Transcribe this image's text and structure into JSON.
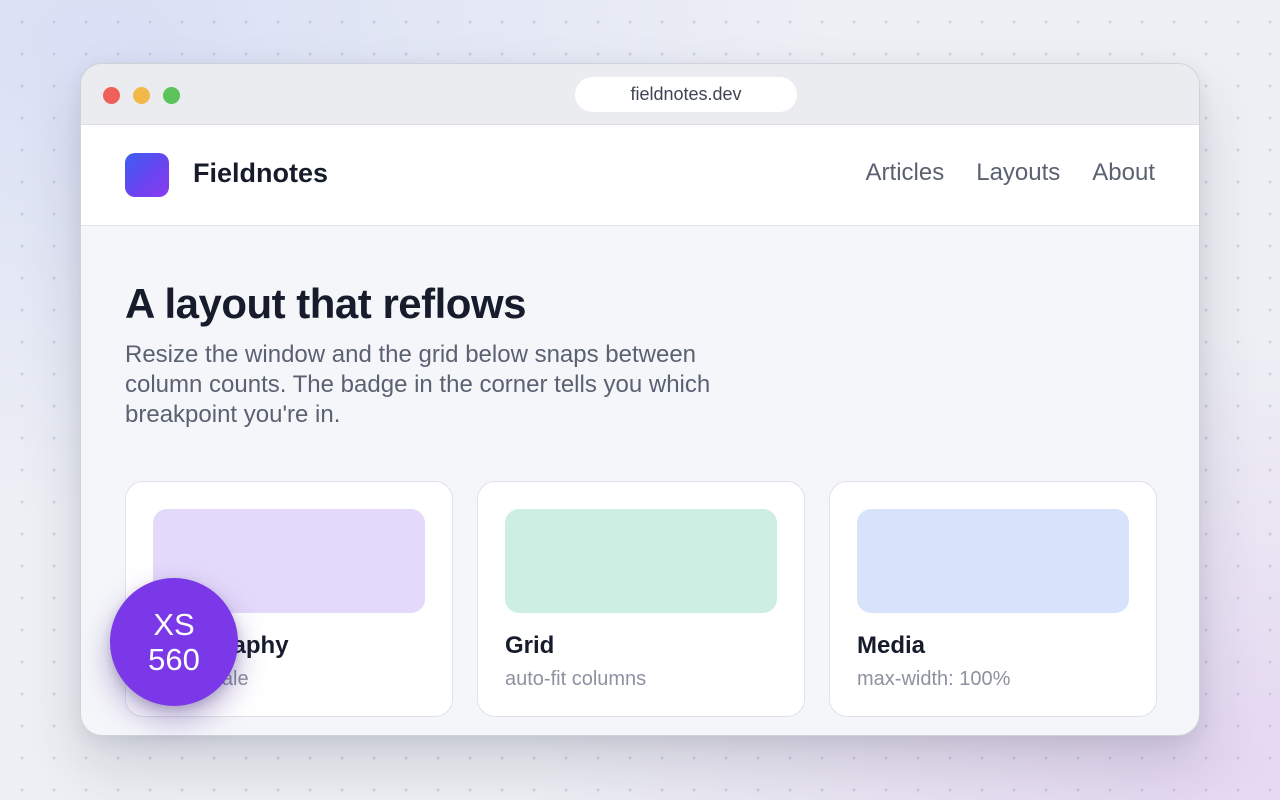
{
  "browser": {
    "url": "fieldnotes.dev"
  },
  "header": {
    "brand": "Fieldnotes",
    "nav": [
      "Articles",
      "Layouts",
      "About"
    ]
  },
  "hero": {
    "title": "A layout that reflows",
    "subtitle": "Resize the window and the grid below snaps between column counts. The badge in the corner tells you which breakpoint you're in."
  },
  "cards": [
    {
      "title": "Typography",
      "subtitle": "Type scale",
      "thumb_color": "#e3d9fa"
    },
    {
      "title": "Grid",
      "subtitle": "auto-fit columns",
      "thumb_color": "#cdeee2"
    },
    {
      "title": "Media",
      "subtitle": "max-width: 100%",
      "thumb_color": "#d6e3fa"
    }
  ],
  "badge": {
    "breakpoint": "XS",
    "width": "560"
  },
  "colors": {
    "accent": "#7a38e8",
    "logo_start": "#3b5ff0",
    "logo_end": "#8a3cf0"
  }
}
